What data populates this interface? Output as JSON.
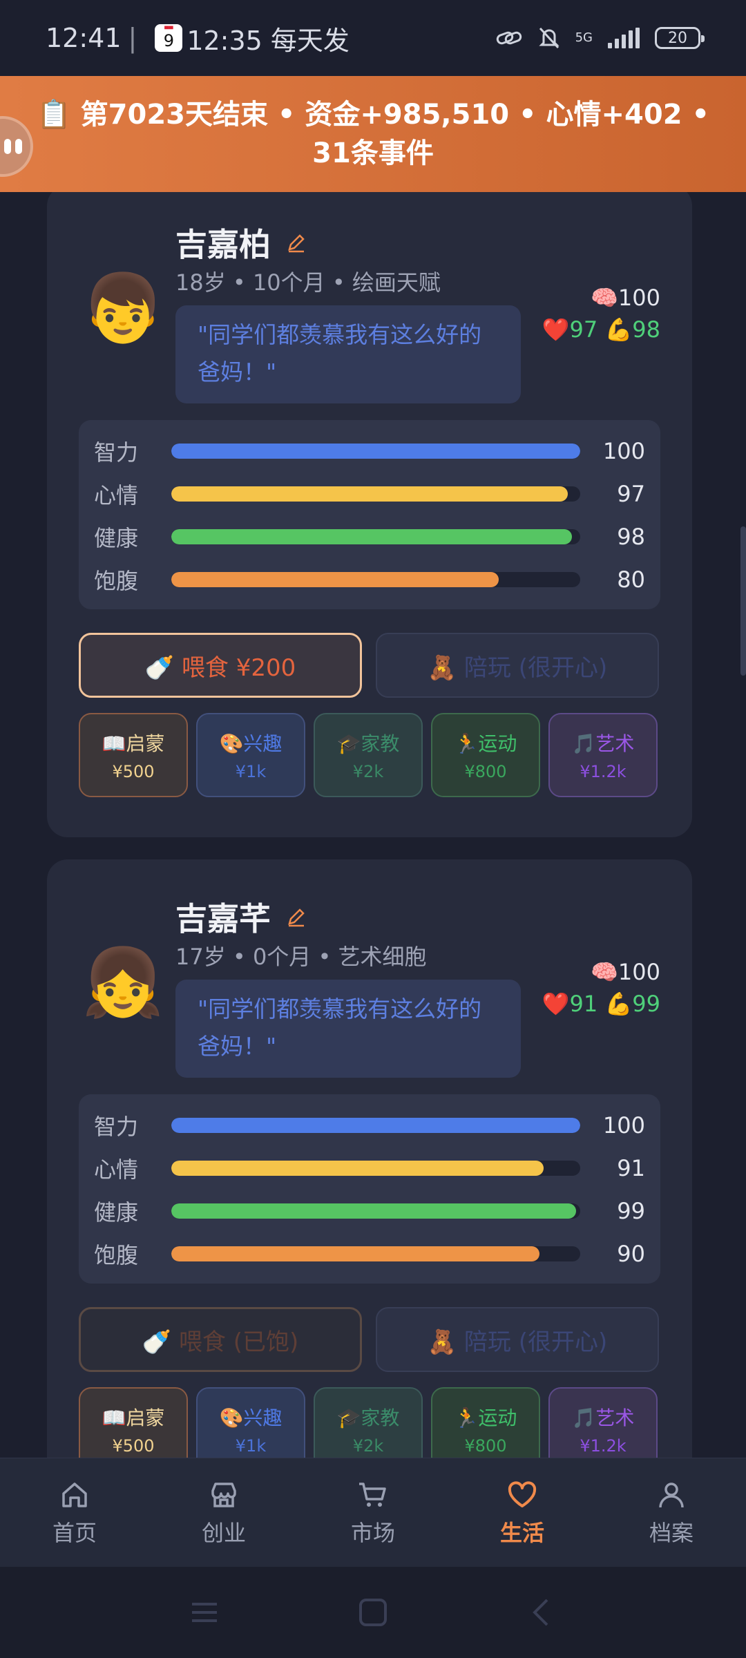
{
  "status_bar": {
    "time": "12:41",
    "calendar_day": "9",
    "notification": "12:35 每天发",
    "battery": "20",
    "network": "5G"
  },
  "banner": {
    "text": "📋 第7023天结束 • 资金+985,510 • 心情+402 • 31条事件"
  },
  "children": [
    {
      "emoji": "👦",
      "name": "吉嘉柏",
      "meta": "18岁 • 10个月 • 绘画天赋",
      "quote": "\"同学们都羡慕我有这么好的爸妈！\"",
      "mini_iq": "🧠100",
      "mini_mood": "❤️97",
      "mini_health": "💪98",
      "stats": [
        {
          "label": "智力",
          "value": "100",
          "level": 1.0,
          "color": "#4e7ce8"
        },
        {
          "label": "心情",
          "value": "97",
          "level": 0.97,
          "color": "#f5c44a"
        },
        {
          "label": "健康",
          "value": "98",
          "level": 0.98,
          "color": "#56c563"
        },
        {
          "label": "饱腹",
          "value": "80",
          "level": 0.8,
          "color": "#ee9447"
        }
      ],
      "feed_label": "🍼 喂食 ¥200",
      "play_label": "🧸 陪玩 (很开心)",
      "tiles": [
        {
          "title": "📖启蒙",
          "price": "¥500"
        },
        {
          "title": "🎨兴趣",
          "price": "¥1k"
        },
        {
          "title": "🎓家教",
          "price": "¥2k"
        },
        {
          "title": "🏃运动",
          "price": "¥800"
        },
        {
          "title": "🎵艺术",
          "price": "¥1.2k"
        }
      ]
    },
    {
      "emoji": "👧",
      "name": "吉嘉芊",
      "meta": "17岁 • 0个月 • 艺术细胞",
      "quote": "\"同学们都羡慕我有这么好的爸妈！\"",
      "mini_iq": "🧠100",
      "mini_mood": "❤️91",
      "mini_health": "💪99",
      "stats": [
        {
          "label": "智力",
          "value": "100",
          "level": 1.0,
          "color": "#4e7ce8"
        },
        {
          "label": "心情",
          "value": "91",
          "level": 0.91,
          "color": "#f5c44a"
        },
        {
          "label": "健康",
          "value": "99",
          "level": 0.99,
          "color": "#56c563"
        },
        {
          "label": "饱腹",
          "value": "90",
          "level": 0.9,
          "color": "#ee9447"
        }
      ],
      "feed_label": "🍼 喂食 (已饱)",
      "play_label": "🧸 陪玩 (很开心)",
      "tiles": [
        {
          "title": "📖启蒙",
          "price": "¥500"
        },
        {
          "title": "🎨兴趣",
          "price": "¥1k"
        },
        {
          "title": "🎓家教",
          "price": "¥2k"
        },
        {
          "title": "🏃运动",
          "price": "¥800"
        },
        {
          "title": "🎵艺术",
          "price": "¥1.2k"
        }
      ]
    }
  ],
  "bottom_nav": [
    {
      "label": "首页",
      "icon": "home-icon"
    },
    {
      "label": "创业",
      "icon": "shop-icon"
    },
    {
      "label": "市场",
      "icon": "cart-icon"
    },
    {
      "label": "生活",
      "icon": "heart-icon",
      "active": true
    },
    {
      "label": "档案",
      "icon": "person-icon"
    }
  ],
  "colors": {
    "accent": "#f08a4b",
    "background": "#1c1f2e",
    "card": "#272b3c"
  }
}
